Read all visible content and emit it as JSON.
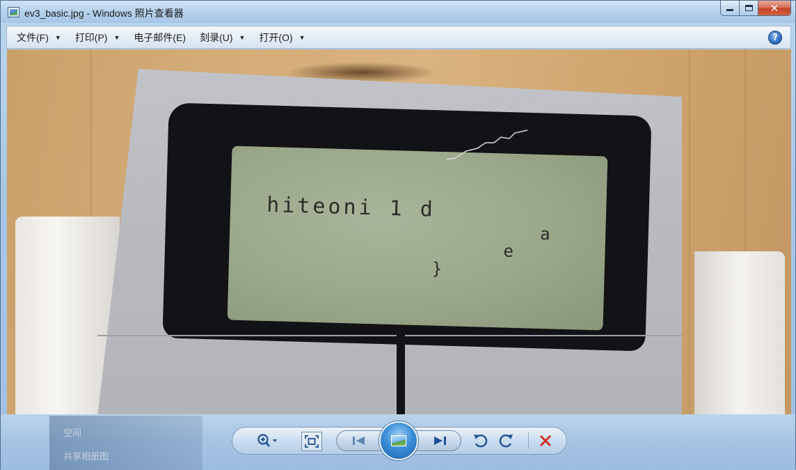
{
  "window": {
    "title": "ev3_basic.jpg - Windows 照片查看器",
    "controls": {
      "minimize": "",
      "maximize": "",
      "close": "✕"
    }
  },
  "menu": {
    "items": [
      {
        "label": "文件(F)",
        "has_arrow": true
      },
      {
        "label": "打印(P)",
        "has_arrow": true
      },
      {
        "label": "电子邮件(E)",
        "has_arrow": false
      },
      {
        "label": "刻录(U)",
        "has_arrow": true
      },
      {
        "label": "打开(O)",
        "has_arrow": true
      }
    ],
    "help": "?"
  },
  "photo": {
    "lcd_line1": "hiteoni 1 d",
    "lcd_a": "a",
    "lcd_e": "e",
    "lcd_brace": "}"
  },
  "taskbar_ghost": {
    "item1": "空间",
    "item2": "共享相册图"
  },
  "controls": {
    "zoom": "zoom-icon",
    "fit": "actual-size-icon",
    "prev": "previous-icon",
    "slideshow": "slideshow-icon",
    "next": "next-icon",
    "rotate_ccw": "rotate-counterclockwise-icon",
    "rotate_cw": "rotate-clockwise-icon",
    "delete": "delete-icon"
  },
  "colors": {
    "accent": "#1d4f98",
    "delete": "#d42a1e"
  }
}
